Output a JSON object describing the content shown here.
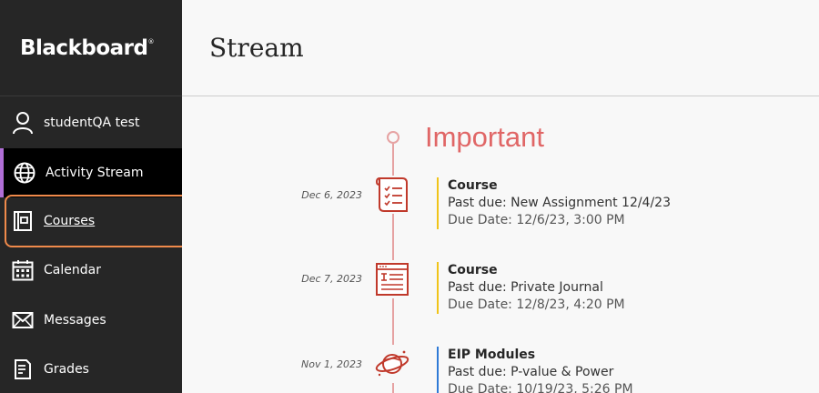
{
  "brand": {
    "logo_text": "Blackboard",
    "trademark": "®"
  },
  "sidebar": {
    "user_name": "studentQA test",
    "items": [
      {
        "label": "Activity Stream",
        "icon": "globe-icon"
      },
      {
        "label": "Courses",
        "icon": "courses-icon"
      },
      {
        "label": "Calendar",
        "icon": "calendar-icon"
      },
      {
        "label": "Messages",
        "icon": "envelope-icon"
      },
      {
        "label": "Grades",
        "icon": "grades-icon"
      }
    ]
  },
  "header": {
    "title": "Stream"
  },
  "stream": {
    "section_title": "Important",
    "items": [
      {
        "date": "Dec 6, 2023",
        "icon": "checklist-icon",
        "title": "Course",
        "line": "Past due: New Assignment 12/4/23",
        "due": "Due Date: 12/6/23, 3:00 PM",
        "accent": "#f0c419"
      },
      {
        "date": "Dec 7, 2023",
        "icon": "journal-icon",
        "title": "Course",
        "line": "Past due: Private Journal",
        "due": "Due Date: 12/8/23, 4:20 PM",
        "accent": "#f0c419"
      },
      {
        "date": "Nov 1, 2023",
        "icon": "planet-icon",
        "title": "EIP Modules",
        "line": "Past due: P-value & Power",
        "due": "Due Date: 10/19/23, 5:26 PM",
        "accent": "#2f7ad6"
      }
    ]
  },
  "colors": {
    "sidebar_bg": "#262626",
    "active_indicator": "#b06ed6",
    "focus_ring": "#f08a4b",
    "important_red": "#e06666",
    "timeline": "#e6a2a2",
    "icon_red": "#c0392b"
  }
}
